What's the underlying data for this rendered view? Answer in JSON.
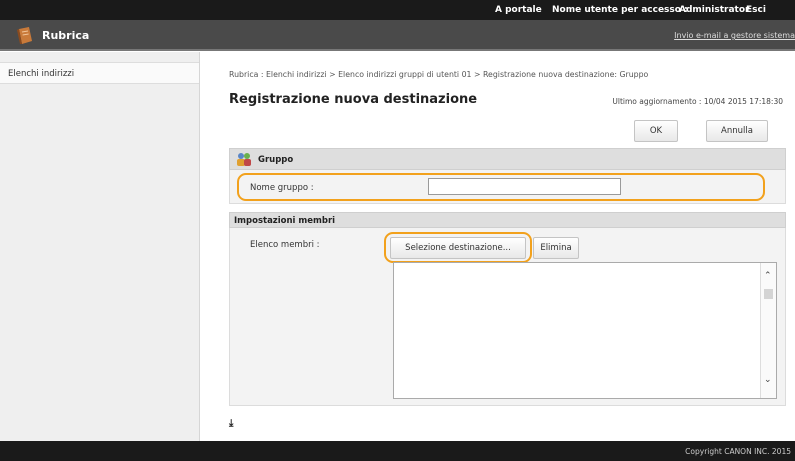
{
  "topbar": {
    "portal_link": "A portale",
    "login_name_label": "Nome utente per accesso :",
    "login_name_value": "Administrator",
    "logout": "Esci"
  },
  "header": {
    "app_title": "Rubrica",
    "mail_link": "Invio e-mail a gestore sistema",
    "logo_icon": "address-book-icon"
  },
  "sidebar": {
    "items": [
      {
        "label": "Elenchi indirizzi"
      }
    ]
  },
  "main": {
    "breadcrumb": "Rubrica : Elenchi indirizzi > Elenco indirizzi gruppi di utenti 01 > Registrazione nuova destinazione: Gruppo",
    "title": "Registrazione nuova destinazione",
    "last_updated": "Ultimo aggiornamento : 10/04 2015 17:18:30",
    "ok_label": "OK",
    "cancel_label": "Annulla",
    "group_section": {
      "title": "Gruppo",
      "icon": "group-icon",
      "name_label": "Nome gruppo :",
      "name_value": ""
    },
    "members_section": {
      "title": "Impostazioni membri",
      "list_label": "Elenco membri :",
      "select_button": "Selezione destinazione...",
      "delete_button": "Elimina",
      "items": []
    },
    "collapse_icon": "collapse-to-top-icon"
  },
  "footer": {
    "copyright": "Copyright CANON INC. 2015"
  },
  "colors": {
    "highlight": "#f2a11c",
    "topbar": "#1a1a1a",
    "header": "#4a4a4a"
  }
}
